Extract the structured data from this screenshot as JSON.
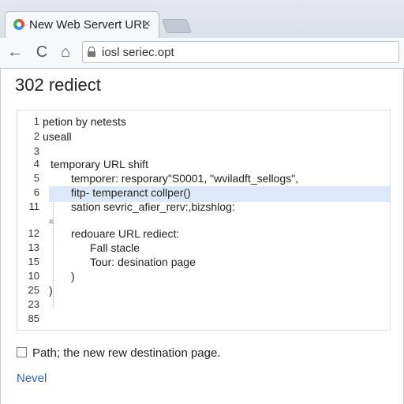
{
  "browser": {
    "tab_title": "New Web Servert URL",
    "tab_close": "×",
    "url": "iosl seriec.opt",
    "nav_back": "←",
    "nav_reload": "C",
    "nav_home": "⌂"
  },
  "page": {
    "title": "302 rediect",
    "code_lines": [
      {
        "num": "1",
        "text": "petion by netests"
      },
      {
        "num": "2",
        "text": "useall"
      },
      {
        "num": "3",
        "text": ""
      },
      {
        "num": "4",
        "text": "temporary URL shift"
      },
      {
        "num": "5",
        "text": "temporer: resporary\"S0001, \"wviladft_sellogs\","
      },
      {
        "num": "6",
        "text": "fitp- temperanct collper()",
        "highlighted": true
      },
      {
        "num": "11",
        "text": "sation sevric_afier_rerv:,bizshlog:"
      },
      {
        "num": "12",
        "text": "redouare URL rediect:"
      },
      {
        "num": "13",
        "text": "Fall stacle"
      },
      {
        "num": "15",
        "text": "Tour: desination page"
      },
      {
        "num": "10",
        "text": ")"
      },
      {
        "num": "25",
        "text": ")"
      },
      {
        "num": "23",
        "text": ""
      },
      {
        "num": "85",
        "text": ""
      }
    ],
    "checkbox_label": "Path; the new rew destination page.",
    "link_text": "Nevel"
  },
  "colors": {
    "highlight": "#dce9fa",
    "link": "#2a64b8",
    "chrome": "#dfe3e9"
  }
}
